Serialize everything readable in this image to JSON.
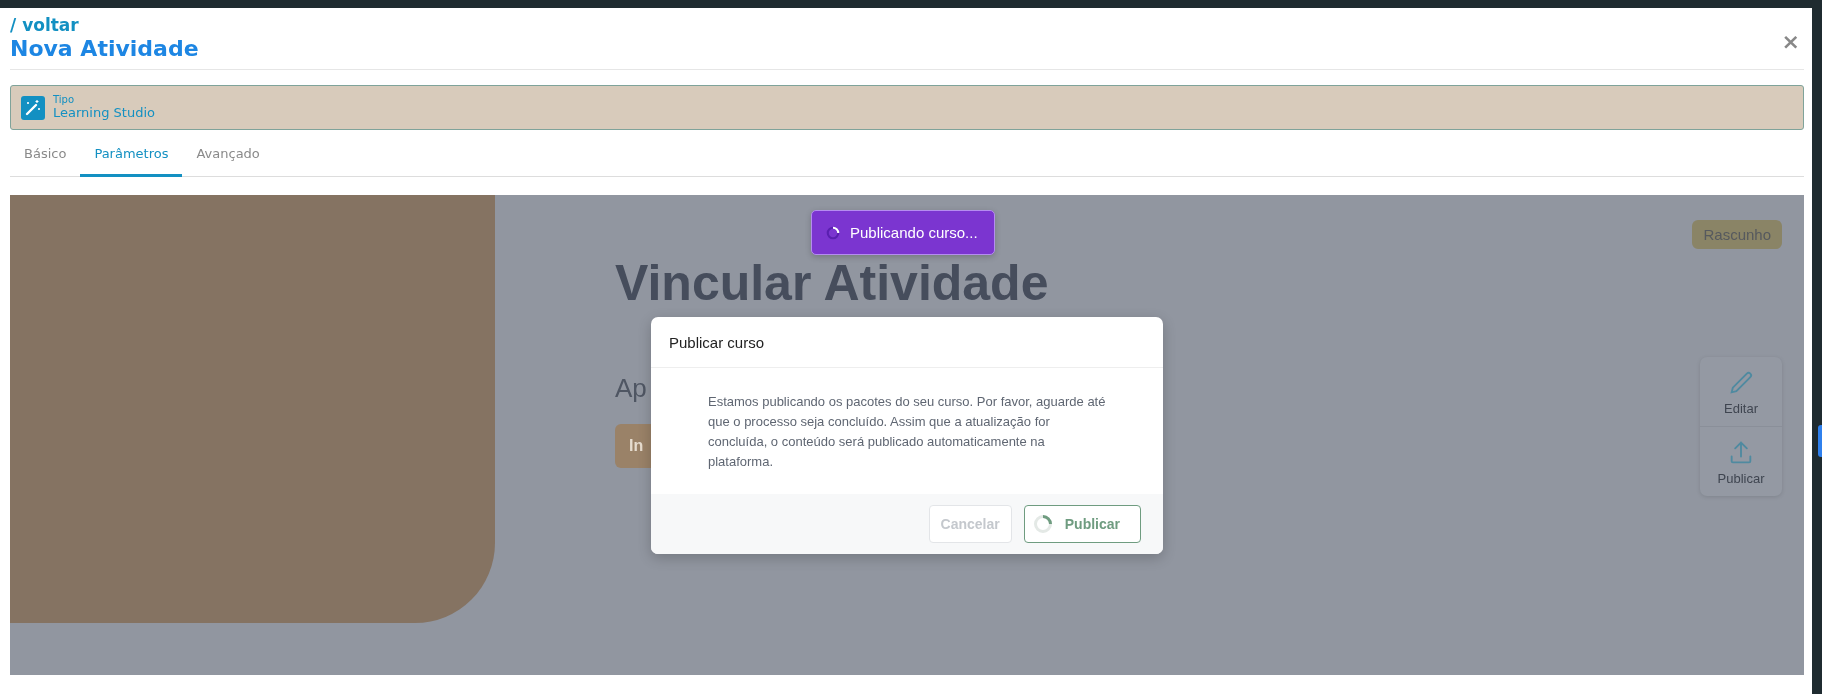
{
  "header": {
    "back_link": "/ voltar",
    "title": "Nova Atividade",
    "close": "×"
  },
  "type_bar": {
    "label": "Tipo",
    "value": "Learning Studio"
  },
  "tabs": [
    {
      "label": "Básico",
      "selected": false
    },
    {
      "label": "Parâmetros",
      "selected": true
    },
    {
      "label": "Avançado",
      "selected": false
    }
  ],
  "preview": {
    "status_badge": "Rascunho",
    "heading": "Vincular Atividade",
    "subtitle": "Ap",
    "button": "In",
    "actions": [
      {
        "kind": "edit",
        "label": "Editar"
      },
      {
        "kind": "publish",
        "label": "Publicar"
      }
    ]
  },
  "toast": {
    "text": "Publicando curso...",
    "loading": true
  },
  "dialog": {
    "title": "Publicar curso",
    "message": "Estamos publicando os pacotes do seu curso. Por favor, aguarde até que o processo seja concluído. Assim que a atualização for concluída, o conteúdo será publicado automaticamente na plataforma.",
    "buttons": [
      {
        "label": "Cancelar",
        "disabled": true,
        "loading": false
      },
      {
        "label": "Publicar",
        "disabled": false,
        "loading": true
      }
    ]
  }
}
